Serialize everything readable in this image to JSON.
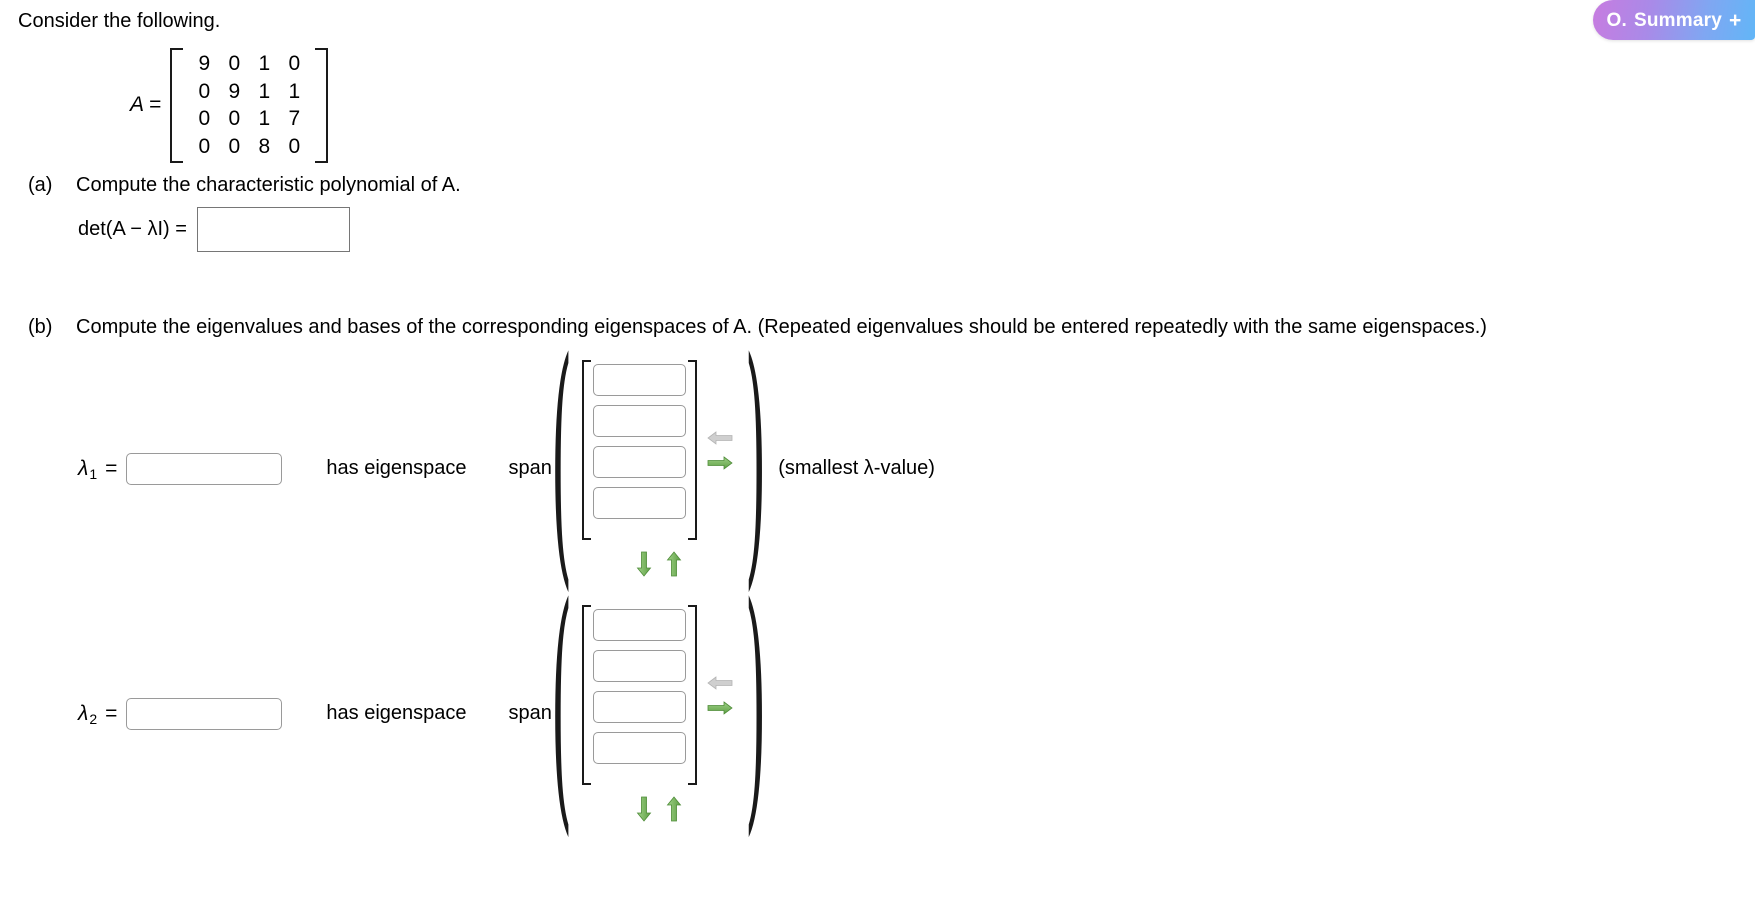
{
  "badge": {
    "icon": "O.",
    "label": "Summary",
    "plus": "+",
    "gradient_from": "#c77ce0",
    "gradient_to": "#62b6f7",
    "text_color": "#ffffff"
  },
  "intro": {
    "text": "Consider the following."
  },
  "matrix": {
    "name": "A",
    "equals": "=",
    "rows": [
      [
        "9",
        "0",
        "1",
        "0"
      ],
      [
        "0",
        "9",
        "1",
        "1"
      ],
      [
        "0",
        "0",
        "1",
        "7"
      ],
      [
        "0",
        "0",
        "8",
        "0"
      ]
    ]
  },
  "part_a": {
    "label": "(a)",
    "text": "Compute the characteristic polynomial of A.",
    "det_label": "det(A − λI)  =",
    "answer_value": "",
    "answer_placeholder": ""
  },
  "part_b": {
    "label": "(b)",
    "text": "Compute the eigenvalues and bases of the corresponding eigenspaces of A. (Repeated eigenvalues should be entered repeatedly with the same eigenspaces.)",
    "has_eigenspace_text": "has eigenspace",
    "span_text": "span",
    "left_paren": "(",
    "right_paren": ")",
    "eigen_rows": [
      {
        "lambda_symbol": "λ",
        "subscript": "1",
        "equals": "=",
        "value": "",
        "placeholder": "",
        "vector": [
          "",
          "",
          "",
          ""
        ],
        "note": "(smallest λ-value)",
        "prev_arrow_enabled": false,
        "next_arrow_enabled": true
      },
      {
        "lambda_symbol": "λ",
        "subscript": "2",
        "equals": "=",
        "value": "",
        "placeholder": "",
        "vector": [
          "",
          "",
          "",
          ""
        ],
        "note": "",
        "prev_arrow_enabled": false,
        "next_arrow_enabled": true
      }
    ]
  },
  "icons": {
    "prev_arrow": "arrow-left-icon",
    "next_arrow": "arrow-right-icon",
    "remove_row_arrow": "arrow-down-icon",
    "add_row_arrow": "arrow-up-icon"
  },
  "colors": {
    "arrow_active": "#7ab75f",
    "arrow_disabled": "#c9c9c9",
    "input_border": "#9a9a9a",
    "text": "#000000"
  }
}
